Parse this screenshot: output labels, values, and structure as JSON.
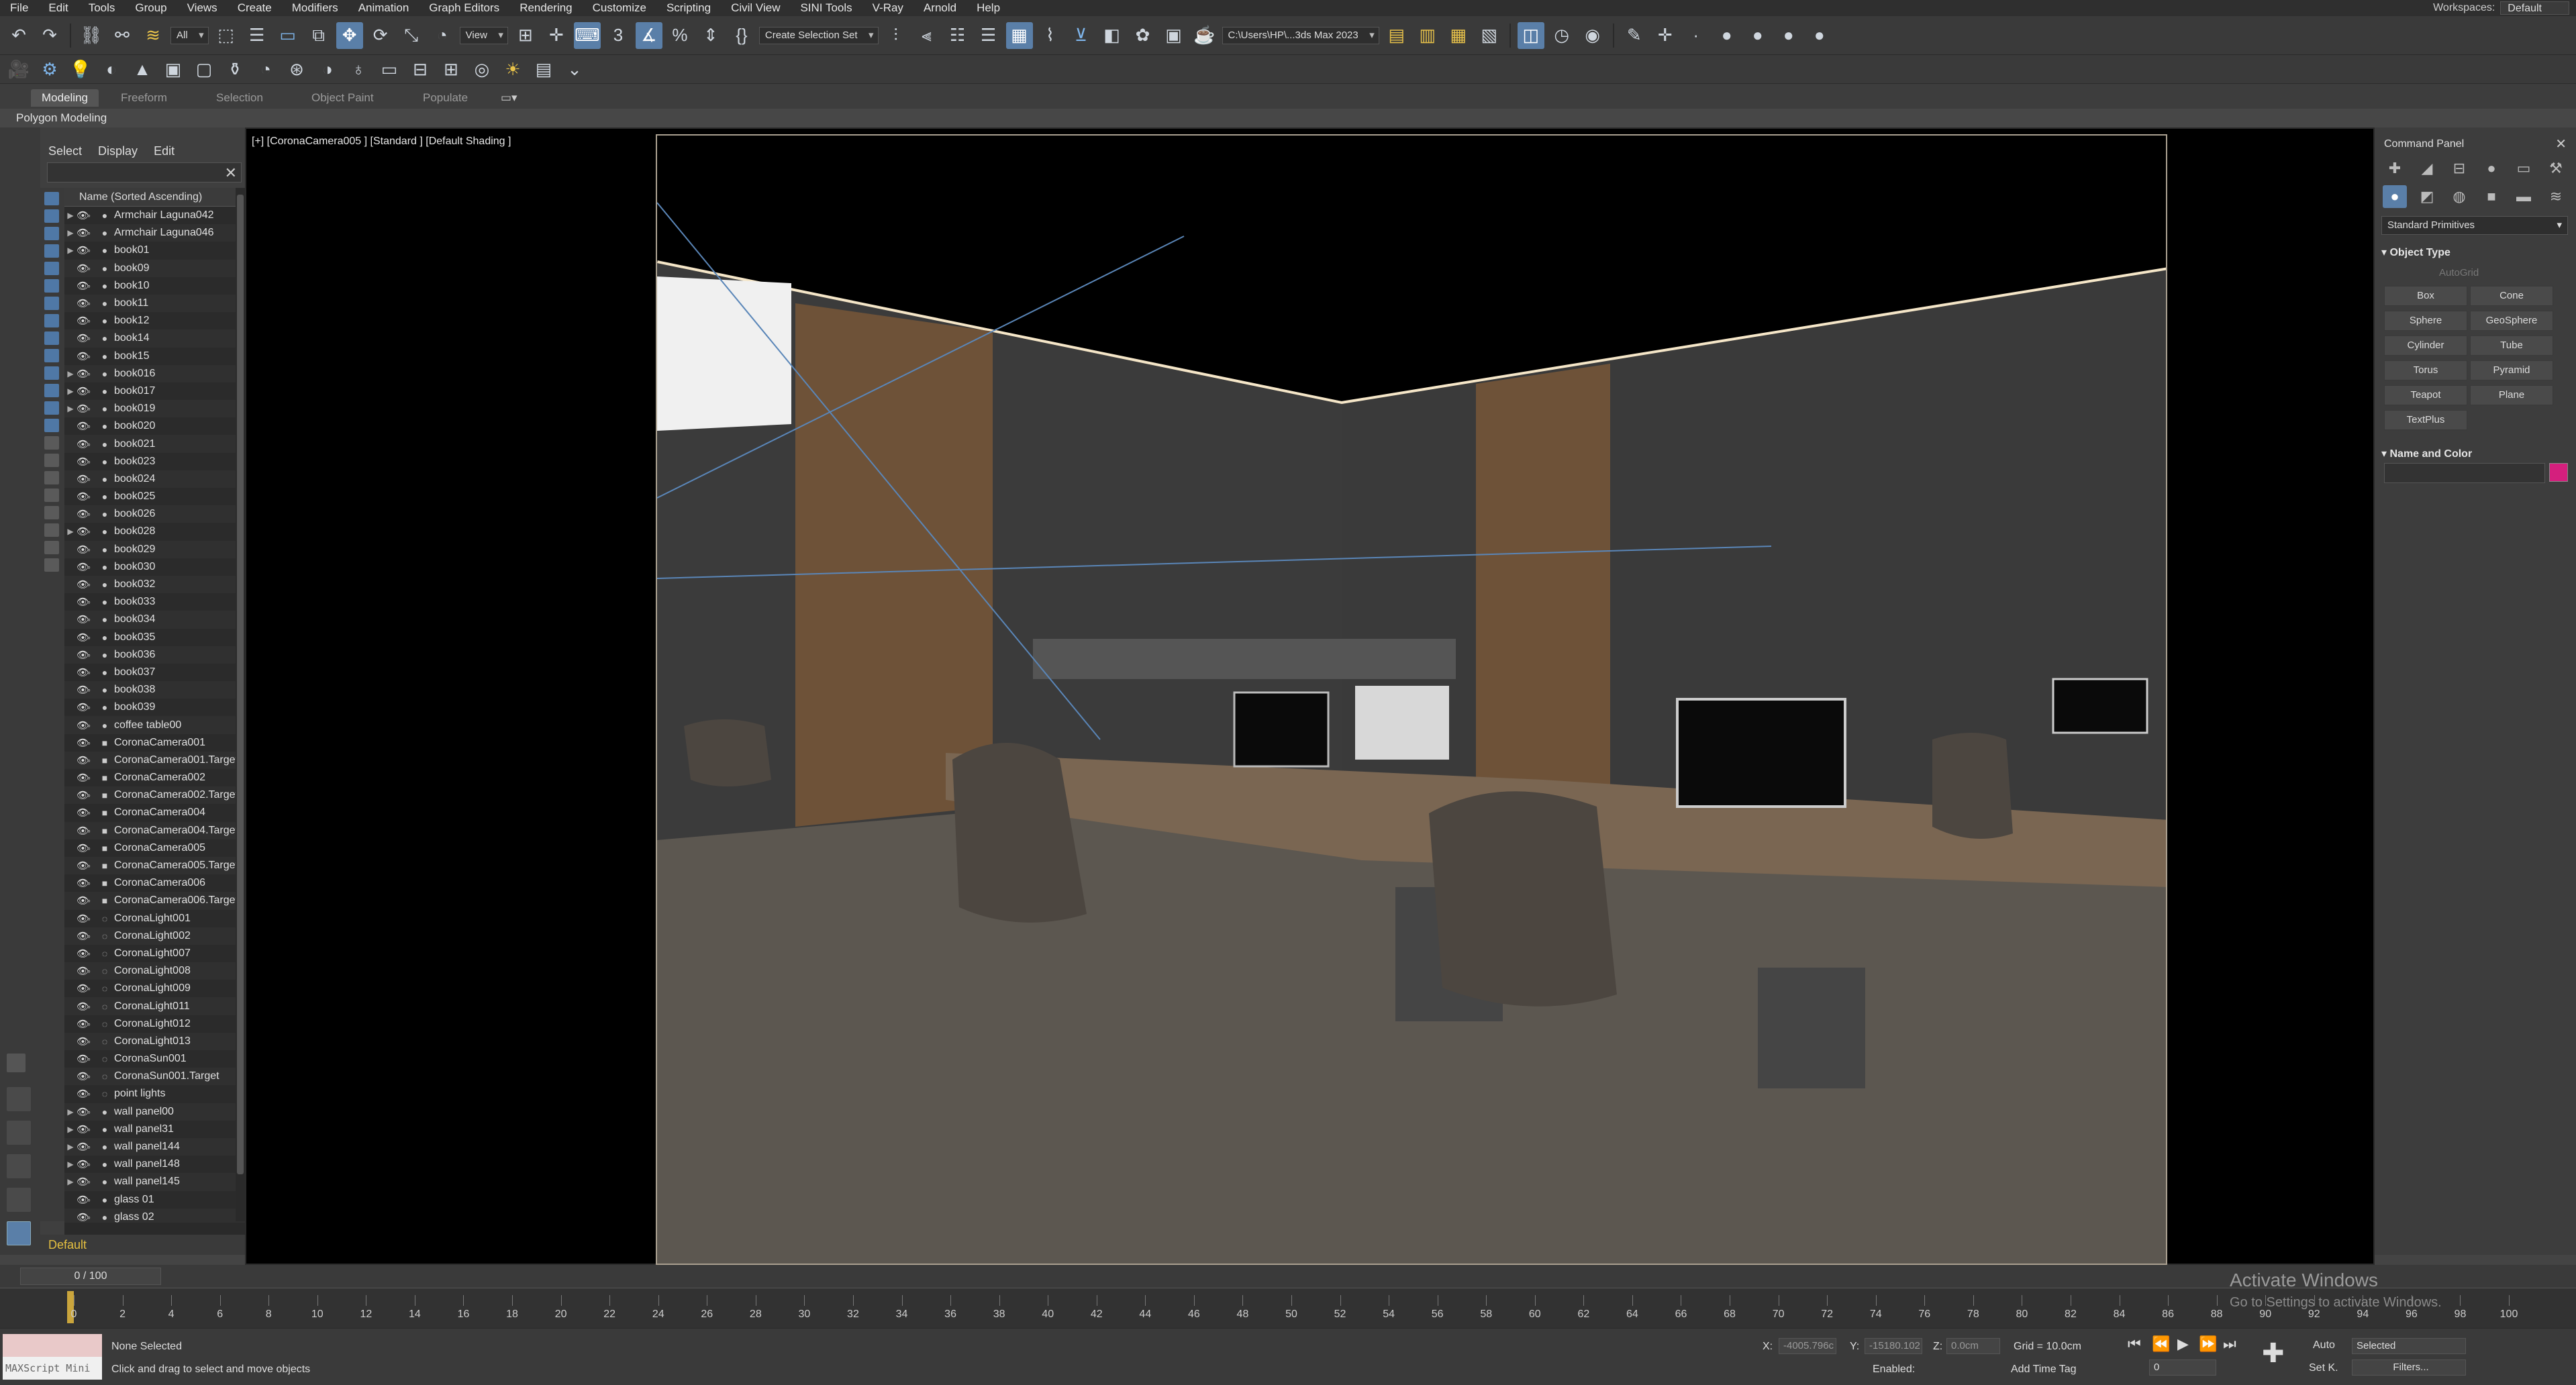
{
  "menu": [
    "File",
    "Edit",
    "Tools",
    "Group",
    "Views",
    "Create",
    "Modifiers",
    "Animation",
    "Graph Editors",
    "Rendering",
    "Customize",
    "Scripting",
    "Civil View",
    "SINI Tools",
    "V-Ray",
    "Arnold",
    "Help"
  ],
  "workspaces": {
    "label": "Workspaces:",
    "value": "Default"
  },
  "toolbar": {
    "selection_filter": "All",
    "ref_coord": "View",
    "named_selection": "Create Selection Set",
    "project_path": "C:\\Users\\HP\\...3ds Max 2023"
  },
  "ribbon": {
    "tabs": [
      "Modeling",
      "Freeform",
      "Selection",
      "Object Paint",
      "Populate"
    ],
    "active": "Modeling",
    "panel": "Polygon Modeling"
  },
  "explorer": {
    "tabs": [
      "Select",
      "Display",
      "Edit"
    ],
    "column_header": "Name (Sorted Ascending)",
    "items": [
      "Armchair Laguna042",
      "Armchair Laguna046",
      "book01",
      "book09",
      "book10",
      "book11",
      "book12",
      "book14",
      "book15",
      "book016",
      "book017",
      "book019",
      "book020",
      "book021",
      "book023",
      "book024",
      "book025",
      "book026",
      "book028",
      "book029",
      "book030",
      "book032",
      "book033",
      "book034",
      "book035",
      "book036",
      "book037",
      "book038",
      "book039",
      "coffee table00",
      "CoronaCamera001",
      "CoronaCamera001.Target",
      "CoronaCamera002",
      "CoronaCamera002.Target",
      "CoronaCamera004",
      "CoronaCamera004.Target",
      "CoronaCamera005",
      "CoronaCamera005.Target",
      "CoronaCamera006",
      "CoronaCamera006.Target",
      "CoronaLight001",
      "CoronaLight002",
      "CoronaLight007",
      "CoronaLight008",
      "CoronaLight009",
      "CoronaLight011",
      "CoronaLight012",
      "CoronaLight013",
      "CoronaSun001",
      "CoronaSun001.Target",
      "point lights",
      "wall panel00",
      "wall panel31",
      "wall panel144",
      "wall panel148",
      "wall panel145",
      "glass 01",
      "glass 02"
    ],
    "layer": "Default"
  },
  "viewport": {
    "label": "[+] [CoronaCamera005 ] [Standard ] [Default Shading ]"
  },
  "command_panel": {
    "title": "Command Panel",
    "category": "Standard Primitives",
    "object_type_title": "Object Type",
    "autogrid": "AutoGrid",
    "buttons": [
      "Box",
      "Cone",
      "Sphere",
      "GeoSphere",
      "Cylinder",
      "Tube",
      "Torus",
      "Pyramid",
      "Teapot",
      "Plane",
      "TextPlus"
    ],
    "name_color_title": "Name and Color",
    "color": "#d41f7d"
  },
  "timeline": {
    "frame": "0 / 100",
    "ticks": [
      "0",
      "2",
      "4",
      "6",
      "8",
      "10",
      "12",
      "14",
      "16",
      "18",
      "20",
      "22",
      "24",
      "26",
      "28",
      "30",
      "32",
      "34",
      "36",
      "38",
      "40",
      "42",
      "44",
      "46",
      "48",
      "50",
      "52",
      "54",
      "56",
      "58",
      "60",
      "62",
      "64",
      "66",
      "68",
      "70",
      "72",
      "74",
      "76",
      "78",
      "80",
      "82",
      "84",
      "86",
      "88",
      "90",
      "92",
      "94",
      "96",
      "98",
      "100"
    ]
  },
  "status": {
    "maxscript": "MAXScript Mini",
    "selection": "None Selected",
    "prompt": "Click and drag to select and move objects",
    "x_label": "X:",
    "x_value": "-4005.796c",
    "y_label": "Y:",
    "y_value": "-15180.102",
    "z_label": "Z:",
    "z_value": "0.0cm",
    "grid": "Grid = 10.0cm",
    "enabled": "Enabled:",
    "add_time_tag": "Add Time Tag",
    "auto": "Auto",
    "set_key": "Set K.",
    "key_filter": "Selected",
    "filters": "Filters...",
    "frame_field": "0"
  },
  "watermark": {
    "line1": "Activate Windows",
    "line2": "Go to Settings to activate Windows."
  }
}
